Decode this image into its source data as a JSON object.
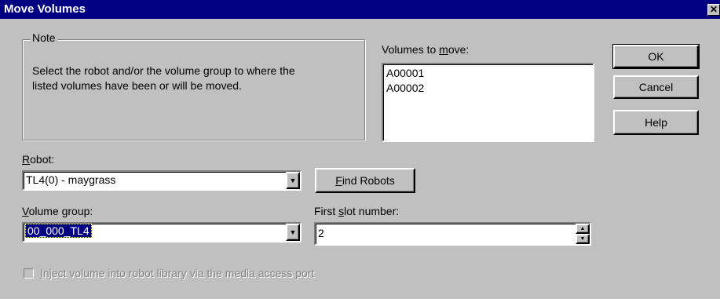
{
  "window": {
    "title": "Move Volumes",
    "close_glyph": "✕"
  },
  "note": {
    "legend": "Note",
    "text": "Select the robot and/or the volume group to where the listed volumes have been or will be moved."
  },
  "volumes": {
    "label_pre": "Volumes to ",
    "label_mnemonic": "m",
    "label_post": "ove:",
    "items": [
      "A00001",
      "A00002"
    ]
  },
  "buttons": {
    "ok": "OK",
    "cancel": "Cancel",
    "help": "Help",
    "find_robots_mnemonic": "F",
    "find_robots_rest": "ind Robots"
  },
  "robot": {
    "label_mnemonic": "R",
    "label_rest": "obot:",
    "value": "TL4(0) - maygrass"
  },
  "volume_group": {
    "label_mnemonic": "V",
    "label_rest": "olume group:",
    "value": "00_000_TL4"
  },
  "first_slot": {
    "label_pre": "First ",
    "label_mnemonic": "s",
    "label_post": "lot number:",
    "value": "2"
  },
  "inject": {
    "label_mnemonic": "I",
    "label_rest": "nject volume into robot library via the media access port",
    "checked": false
  }
}
